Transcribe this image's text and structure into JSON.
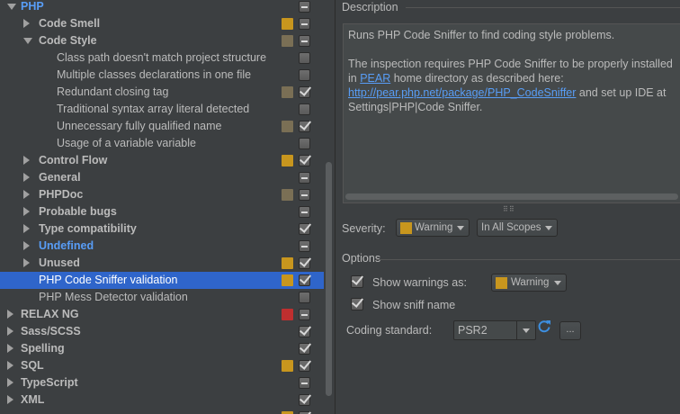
{
  "colors": {
    "warning": "#c8961e",
    "weak_warning": "#7a6f55",
    "error": "#bf2f2f",
    "selection": "#2f65ca",
    "link": "#589df6"
  },
  "tree": {
    "items": [
      {
        "label": "PHP",
        "style": "blue",
        "expander": "down",
        "indent": 0,
        "sev": null,
        "check": "partial"
      },
      {
        "label": "Code Smell",
        "style": "bold",
        "expander": "right",
        "indent": 1,
        "sev": "warning",
        "check": "partial"
      },
      {
        "label": "Code Style",
        "style": "bold",
        "expander": "down",
        "indent": 1,
        "sev": "weak_warning",
        "check": "partial"
      },
      {
        "label": "Class path doesn't match project structure",
        "style": "normal",
        "expander": null,
        "indent": 2,
        "sev": null,
        "check": "unchecked"
      },
      {
        "label": "Multiple classes declarations in one file",
        "style": "normal",
        "expander": null,
        "indent": 2,
        "sev": null,
        "check": "unchecked"
      },
      {
        "label": "Redundant closing tag",
        "style": "normal",
        "expander": null,
        "indent": 2,
        "sev": "weak_warning",
        "check": "checked"
      },
      {
        "label": "Traditional syntax array literal detected",
        "style": "normal",
        "expander": null,
        "indent": 2,
        "sev": null,
        "check": "unchecked"
      },
      {
        "label": "Unnecessary fully qualified name",
        "style": "normal",
        "expander": null,
        "indent": 2,
        "sev": "weak_warning",
        "check": "checked"
      },
      {
        "label": "Usage of a variable variable",
        "style": "normal",
        "expander": null,
        "indent": 2,
        "sev": null,
        "check": "unchecked"
      },
      {
        "label": "Control Flow",
        "style": "bold",
        "expander": "right",
        "indent": 1,
        "sev": "warning",
        "check": "checked"
      },
      {
        "label": "General",
        "style": "bold",
        "expander": "right",
        "indent": 1,
        "sev": null,
        "check": "partial"
      },
      {
        "label": "PHPDoc",
        "style": "bold",
        "expander": "right",
        "indent": 1,
        "sev": "weak_warning",
        "check": "partial"
      },
      {
        "label": "Probable bugs",
        "style": "bold",
        "expander": "right",
        "indent": 1,
        "sev": null,
        "check": "partial"
      },
      {
        "label": "Type compatibility",
        "style": "bold",
        "expander": "right",
        "indent": 1,
        "sev": null,
        "check": "checked"
      },
      {
        "label": "Undefined",
        "style": "blue",
        "expander": "right",
        "indent": 1,
        "sev": null,
        "check": "partial"
      },
      {
        "label": "Unused",
        "style": "bold",
        "expander": "right",
        "indent": 1,
        "sev": "warning",
        "check": "checked"
      },
      {
        "label": "PHP Code Sniffer validation",
        "style": "normal",
        "expander": null,
        "indent": 1,
        "sev": "warning",
        "check": "checked",
        "selected": true
      },
      {
        "label": "PHP Mess Detector validation",
        "style": "normal",
        "expander": null,
        "indent": 1,
        "sev": null,
        "check": "unchecked"
      },
      {
        "label": "RELAX NG",
        "style": "bold",
        "expander": "right",
        "indent": 0,
        "sev": "error",
        "check": "partial"
      },
      {
        "label": "Sass/SCSS",
        "style": "bold",
        "expander": "right",
        "indent": 0,
        "sev": null,
        "check": "checked"
      },
      {
        "label": "Spelling",
        "style": "bold",
        "expander": "right",
        "indent": 0,
        "sev": null,
        "check": "checked"
      },
      {
        "label": "SQL",
        "style": "bold",
        "expander": "right",
        "indent": 0,
        "sev": "warning",
        "check": "checked"
      },
      {
        "label": "TypeScript",
        "style": "bold",
        "expander": "right",
        "indent": 0,
        "sev": null,
        "check": "partial"
      },
      {
        "label": "XML",
        "style": "bold",
        "expander": "right",
        "indent": 0,
        "sev": null,
        "check": "checked"
      },
      {
        "label": "",
        "style": "bold",
        "expander": null,
        "indent": 0,
        "sev": "warning",
        "check": "checked"
      }
    ]
  },
  "description": {
    "title": "Description",
    "p1": "Runs PHP Code Sniffer to find coding style problems.",
    "p2_a": "The inspection requires PHP Code Sniffer to be properly installed in ",
    "p2_link1": "PEAR",
    "p2_b": " home directory as described here: ",
    "p2_link2": "http://pear.php.net/package/PHP_CodeSniffer",
    "p2_c": " and set up IDE at Settings|PHP|Code Sniffer."
  },
  "severity": {
    "label": "Severity:",
    "value": "Warning",
    "scope": "In All Scopes"
  },
  "options": {
    "title": "Options",
    "show_warnings_label": "Show warnings as:",
    "show_warnings_value": "Warning",
    "show_sniff_label": "Show sniff name",
    "coding_standard_label": "Coding standard:",
    "coding_standard_value": "PSR2",
    "more_label": "..."
  },
  "icons": {
    "refresh": "refresh-icon",
    "expander": "expander-arrow-icon"
  }
}
